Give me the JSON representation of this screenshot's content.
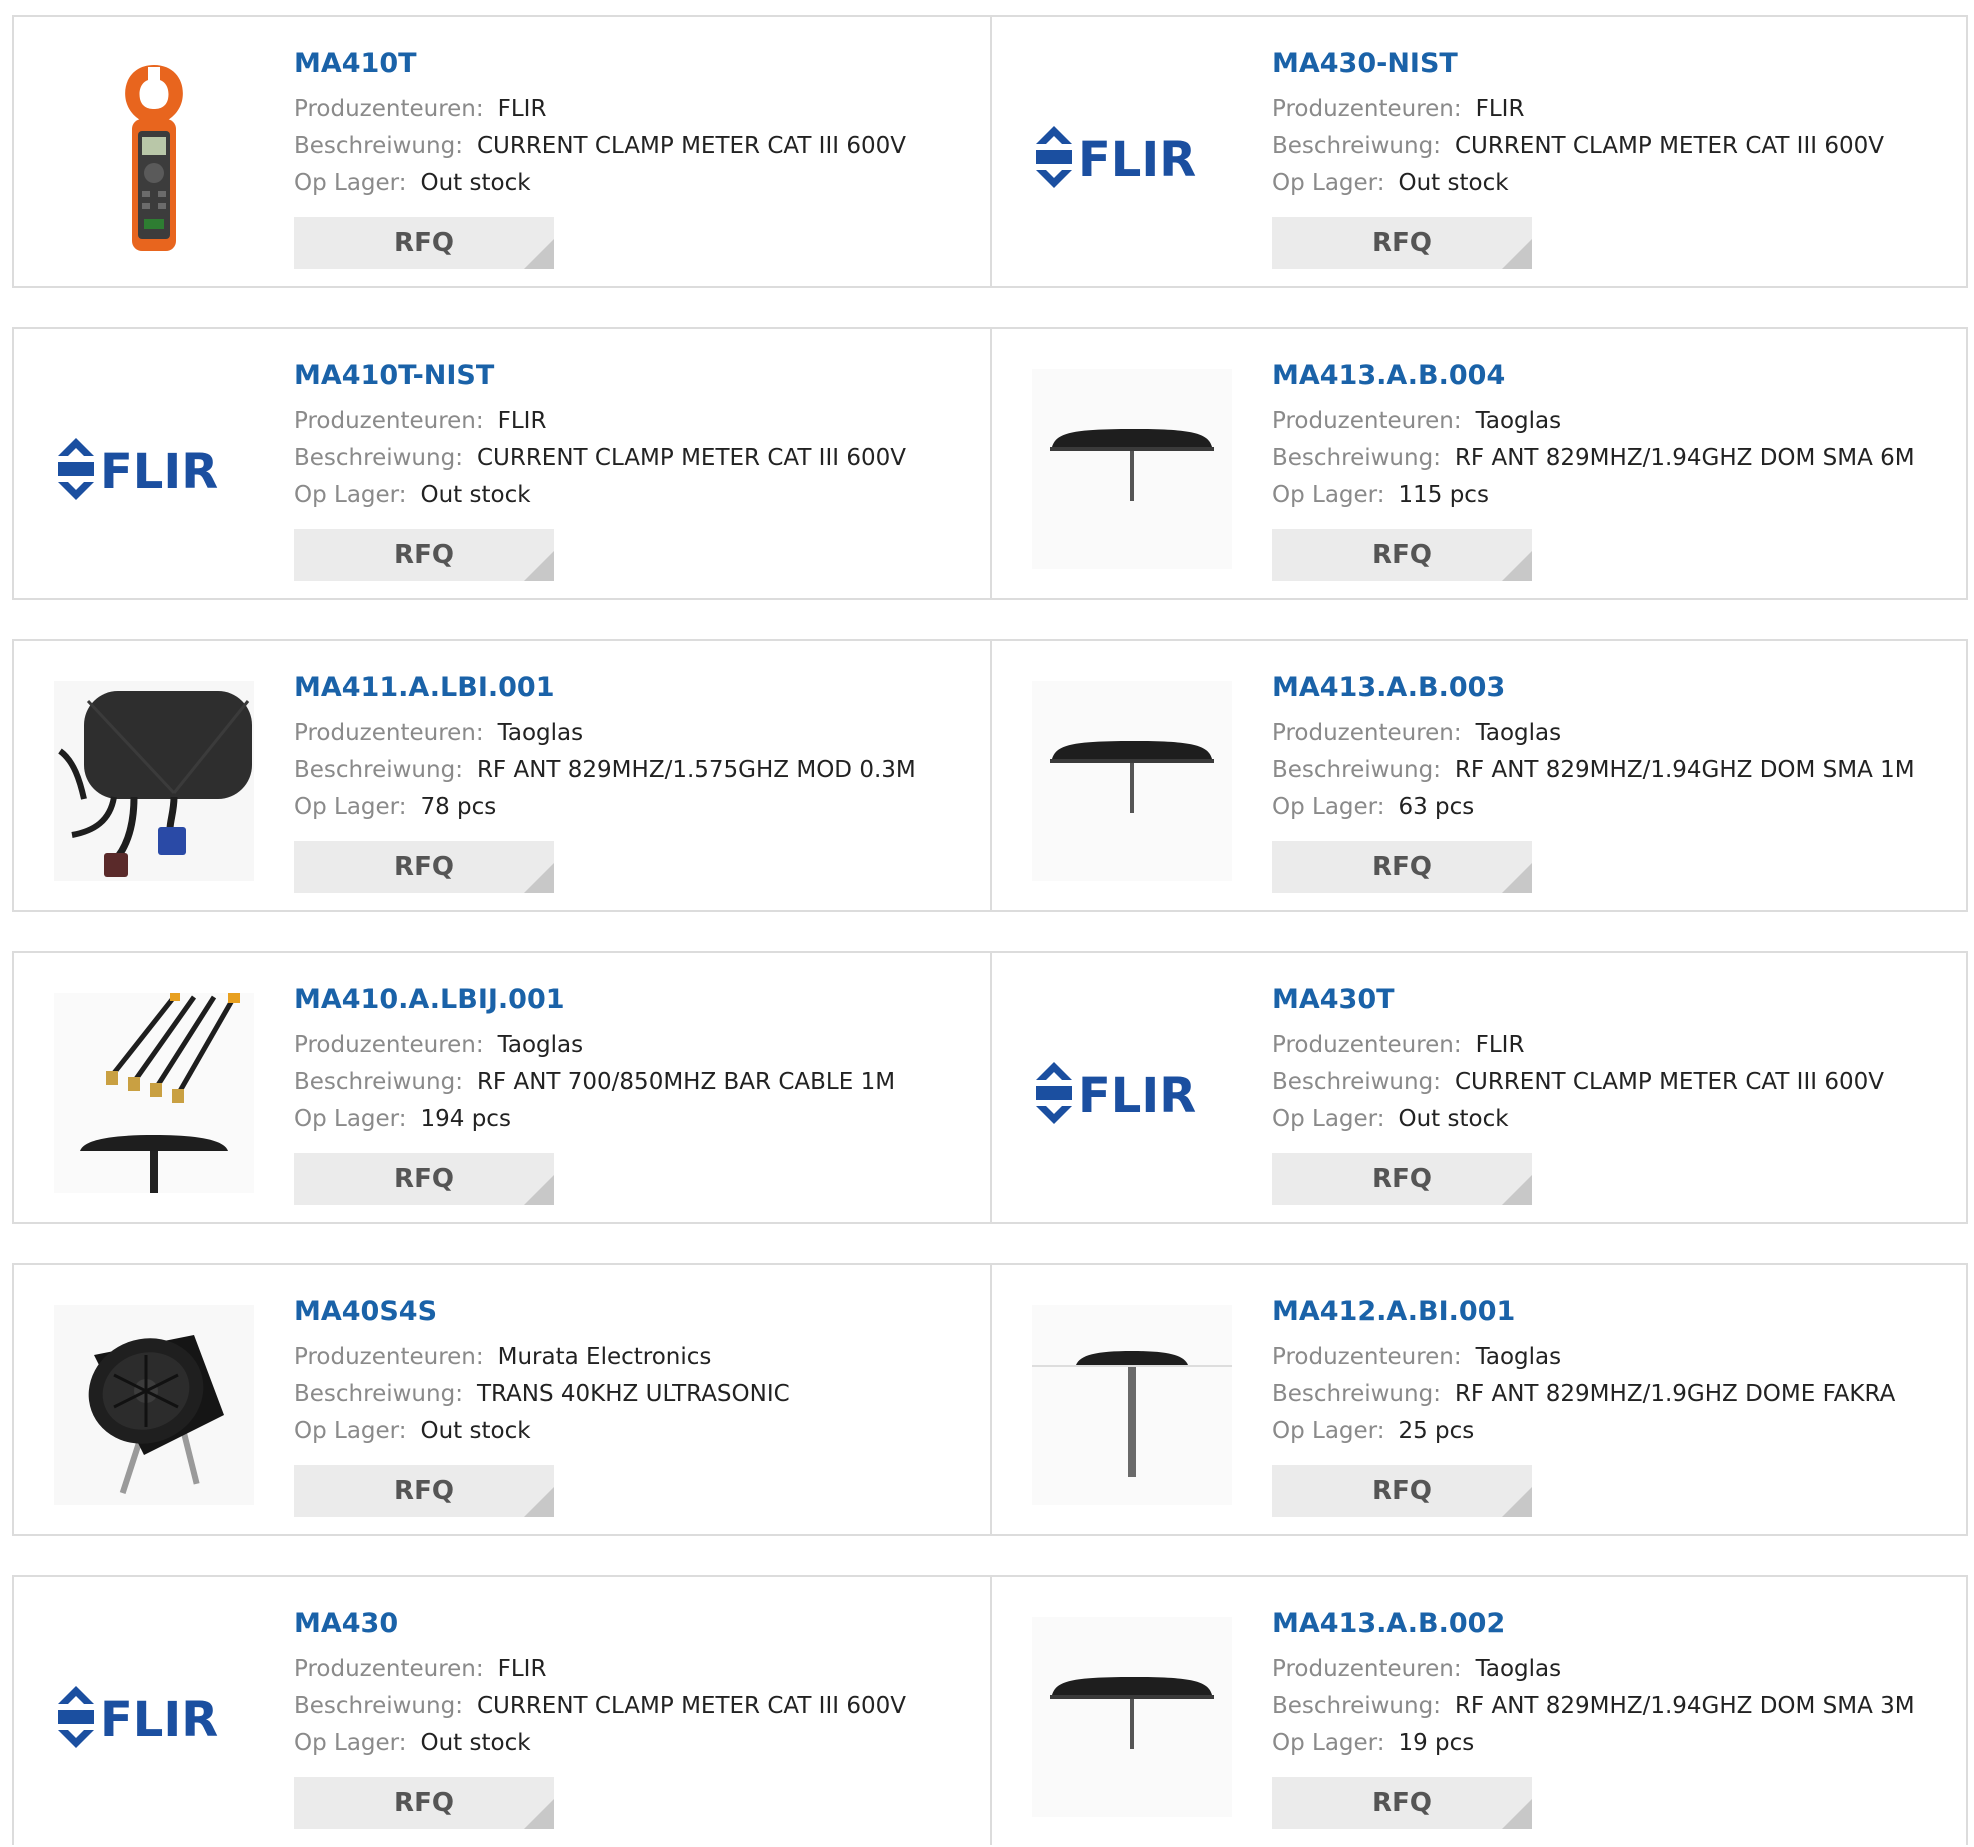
{
  "labels": {
    "manufacturer": "Produzenteuren:",
    "description": "Beschreiwung:",
    "stock": "Op Lager:",
    "rfq": "RFQ"
  },
  "products": [
    {
      "part": "MA410T",
      "manufacturer": "FLIR",
      "description": "CURRENT CLAMP METER CAT III 600V",
      "stock": "Out stock",
      "image": "clamp-meter-image"
    },
    {
      "part": "MA430-NIST",
      "manufacturer": "FLIR",
      "description": "CURRENT CLAMP METER CAT III 600V",
      "stock": "Out stock",
      "image": "flir-logo",
      "logo_text": "FLIR"
    },
    {
      "part": "MA410T-NIST",
      "manufacturer": "FLIR",
      "description": "CURRENT CLAMP METER CAT III 600V",
      "stock": "Out stock",
      "image": "flir-logo",
      "logo_text": "FLIR"
    },
    {
      "part": "MA413.A.B.004",
      "manufacturer": "Taoglas",
      "description": "RF ANT 829MHZ/1.94GHZ DOM SMA 6M",
      "stock": "115 pcs",
      "image": "dome-antenna-image"
    },
    {
      "part": "MA411.A.LBI.001",
      "manufacturer": "Taoglas",
      "description": "RF ANT 829MHZ/1.575GHZ MOD 0.3M",
      "stock": "78 pcs",
      "image": "panel-antenna-image"
    },
    {
      "part": "MA413.A.B.003",
      "manufacturer": "Taoglas",
      "description": "RF ANT 829MHZ/1.94GHZ DOM SMA 1M",
      "stock": "63 pcs",
      "image": "dome-antenna-image"
    },
    {
      "part": "MA410.A.LBIJ.001",
      "manufacturer": "Taoglas",
      "description": "RF ANT 700/850MHZ BAR CABLE 1M",
      "stock": "194 pcs",
      "image": "cable-antenna-image"
    },
    {
      "part": "MA430T",
      "manufacturer": "FLIR",
      "description": "CURRENT CLAMP METER CAT III 600V",
      "stock": "Out stock",
      "image": "flir-logo",
      "logo_text": "FLIR"
    },
    {
      "part": "MA40S4S",
      "manufacturer": "Murata Electronics",
      "description": "TRANS 40KHZ ULTRASONIC",
      "stock": "Out stock",
      "image": "ultrasonic-sensor-image"
    },
    {
      "part": "MA412.A.BI.001",
      "manufacturer": "Taoglas",
      "description": "RF ANT 829MHZ/1.9GHZ DOME FAKRA",
      "stock": "25 pcs",
      "image": "t-antenna-image"
    },
    {
      "part": "MA430",
      "manufacturer": "FLIR",
      "description": "CURRENT CLAMP METER CAT III 600V",
      "stock": "Out stock",
      "image": "flir-logo",
      "logo_text": "FLIR"
    },
    {
      "part": "MA413.A.B.002",
      "manufacturer": "Taoglas",
      "description": "RF ANT 829MHZ/1.94GHZ DOM SMA 3M",
      "stock": "19 pcs",
      "image": "dome-antenna-image"
    }
  ],
  "colors": {
    "part_link": "#1a62a8",
    "flir_blue": "#1b4fa0",
    "border": "#dcdcdc",
    "button_bg": "#ebebeb"
  }
}
